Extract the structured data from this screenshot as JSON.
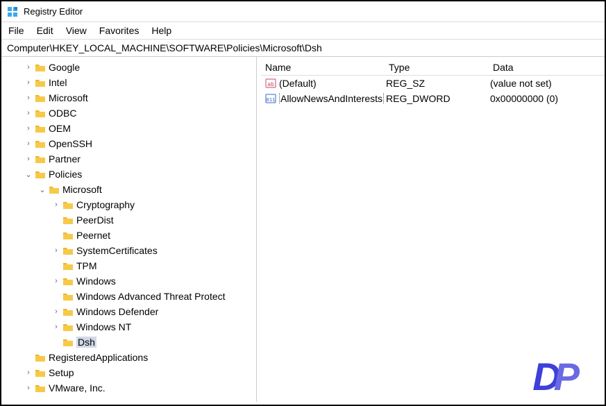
{
  "titlebar": {
    "title": "Registry Editor"
  },
  "menu": {
    "file": "File",
    "edit": "Edit",
    "view": "View",
    "favorites": "Favorites",
    "help": "Help"
  },
  "address": "Computer\\HKEY_LOCAL_MACHINE\\SOFTWARE\\Policies\\Microsoft\\Dsh",
  "tree": {
    "n0": "Google",
    "n1": "Intel",
    "n2": "Microsoft",
    "n3": "ODBC",
    "n4": "OEM",
    "n5": "OpenSSH",
    "n6": "Partner",
    "n7": "Policies",
    "n8": "Microsoft",
    "n9": "Cryptography",
    "n10": "PeerDist",
    "n11": "Peernet",
    "n12": "SystemCertificates",
    "n13": "TPM",
    "n14": "Windows",
    "n15": "Windows Advanced Threat Protect",
    "n16": "Windows Defender",
    "n17": "Windows NT",
    "n18": "Dsh",
    "n19": "RegisteredApplications",
    "n20": "Setup",
    "n21": "VMware, Inc."
  },
  "list": {
    "head": {
      "name": "Name",
      "type": "Type",
      "data": "Data"
    },
    "rows": [
      {
        "name": "(Default)",
        "type": "REG_SZ",
        "data": "(value not set)",
        "icon": "sz"
      },
      {
        "name": "AllowNewsAndInterests",
        "type": "REG_DWORD",
        "data": "0x00000000 (0)",
        "icon": "dw",
        "selected": true
      }
    ]
  },
  "watermark": {
    "a": "D",
    "b": "P"
  }
}
